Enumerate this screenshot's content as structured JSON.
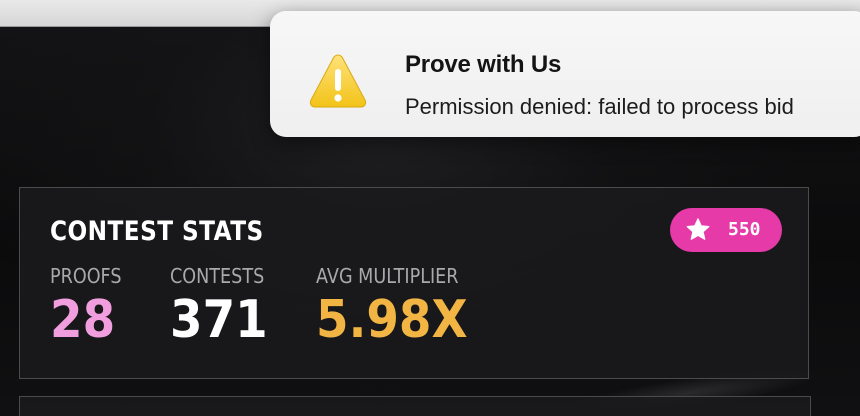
{
  "notification": {
    "title": "Prove with Us",
    "message": "Permission denied: failed to process bid",
    "icon": "warning-icon"
  },
  "contest_stats": {
    "title": "CONTEST STATS",
    "badge": {
      "icon": "star-icon",
      "value": "550",
      "color": "#e73aa9"
    },
    "stats": [
      {
        "label": "PROOFS",
        "value": "28",
        "color": "#f19ede"
      },
      {
        "label": "CONTESTS",
        "value": "371",
        "color": "#ffffff"
      },
      {
        "label": "AVG MULTIPLIER",
        "value": "5.98X",
        "color": "#f2b544"
      }
    ]
  }
}
